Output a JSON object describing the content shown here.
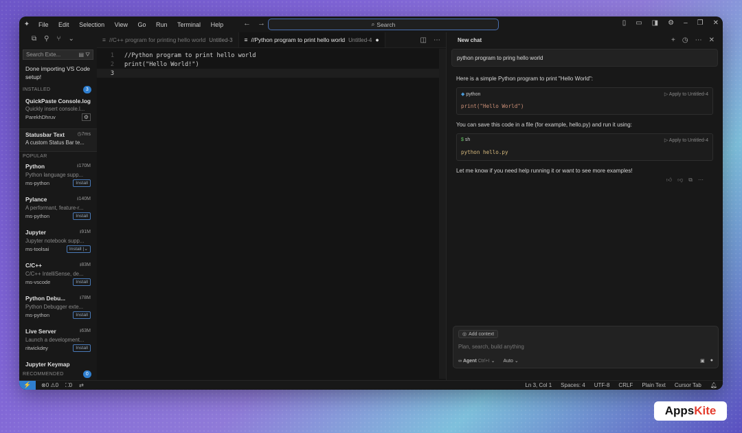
{
  "menu": [
    "File",
    "Edit",
    "Selection",
    "View",
    "Go",
    "Run",
    "Terminal",
    "Help"
  ],
  "search": {
    "label": "Search"
  },
  "sidebar": {
    "search_placeholder": "Search Exte...",
    "notice": "Done importing VS Code setup!",
    "installed_label": "INSTALLED",
    "installed_count": "3",
    "installed": [
      {
        "name": "QuickPaste Console.log",
        "desc": "Quickly insert console.l...",
        "publisher": "ParekhDhruv"
      },
      {
        "name": "Statusbar Text",
        "time": "7ms",
        "desc": "A custom Status Bar te..."
      }
    ],
    "popular_label": "POPULAR",
    "popular": [
      {
        "name": "Python",
        "downloads": "170M",
        "desc": "Python language supp...",
        "publisher": "ms-python",
        "button": "Install"
      },
      {
        "name": "Pylance",
        "downloads": "140M",
        "desc": "A performant, feature-r...",
        "publisher": "ms-python",
        "button": "Install"
      },
      {
        "name": "Jupyter",
        "downloads": "91M",
        "desc": "Jupyter notebook supp...",
        "publisher": "ms-toolsai",
        "button": "Install"
      },
      {
        "name": "C/C++",
        "downloads": "83M",
        "desc": "C/C++ IntelliSense, de...",
        "publisher": "ms-vscode",
        "button": "Install"
      },
      {
        "name": "Python Debu...",
        "downloads": "78M",
        "desc": "Python Debugger exte...",
        "publisher": "ms-python",
        "button": "Install"
      },
      {
        "name": "Live Server",
        "downloads": "63M",
        "desc": "Launch a development...",
        "publisher": "ritwickdey",
        "button": "Install"
      },
      {
        "name": "Jupyter Keymap"
      }
    ],
    "recommended_label": "RECOMMENDED",
    "recommended_count": "0"
  },
  "tabs": [
    {
      "title": "//C++ program for printing hello world",
      "sub": "Untitled-3"
    },
    {
      "title": "//Python program to print hello world",
      "sub": "Untitled-4"
    }
  ],
  "code": [
    {
      "n": "1",
      "t": "//Python program to print hello world"
    },
    {
      "n": "2",
      "t": "print(\"Hello World!\")"
    },
    {
      "n": "3",
      "t": ""
    }
  ],
  "chat": {
    "title": "New chat",
    "user_message": "python program to pring hello world",
    "intro": "Here is a simple Python program to print \"Hello World\":",
    "block1": {
      "lang": "python",
      "apply": "Apply to Untitled-4",
      "code": "print(\"Hello World\")"
    },
    "middle": "You can save this code in a file (for example, hello.py) and run it using:",
    "block2": {
      "lang": "sh",
      "apply": "Apply to Untitled-4",
      "code": "python hello.py"
    },
    "outro": "Let me know if you need help running it or want to see more examples!",
    "add_context": "Add context",
    "placeholder": "Plan, search, build anything",
    "mode": "Agent",
    "mode_shortcut": "Ctrl+I",
    "model": "Auto"
  },
  "status": {
    "errors": "0",
    "warnings": "0",
    "ports": "0",
    "position": "Ln 3, Col 1",
    "spaces": "Spaces: 4",
    "encoding": "UTF-8",
    "eol": "CRLF",
    "language": "Plain Text",
    "tab": "Cursor Tab"
  },
  "badge": {
    "a": "Apps",
    "b": "Kite"
  },
  "colors": {
    "accent": "#2f7fd0",
    "string": "#ce9178",
    "keyword": "#c586c0"
  }
}
